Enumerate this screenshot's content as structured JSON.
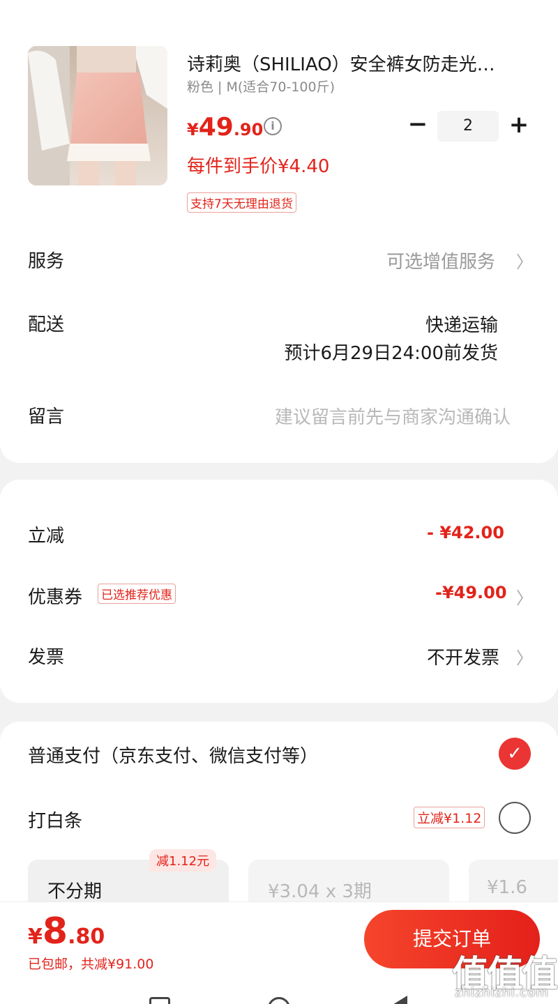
{
  "product": {
    "title": "诗莉奥（SHILIAO）安全裤女防走光…",
    "spec": "粉色 | M(适合70-100斤)",
    "price_currency": "¥",
    "price_int": "49",
    "price_dec": ".90",
    "unit_price": "每件到手价¥4.40",
    "returns_badge": "支持7天无理由退货",
    "quantity": "2",
    "minus": "−",
    "plus": "+"
  },
  "rows": {
    "service_label": "服务",
    "service_value": "可选增值服务",
    "delivery_label": "配送",
    "delivery_method": "快递运输",
    "delivery_eta": "预计6月29日24:00前发货",
    "message_label": "留言",
    "message_placeholder": "建议留言前先与商家沟通确认"
  },
  "discounts": {
    "instant_label": "立减",
    "instant_value": "- ¥42.00",
    "coupon_label": "优惠券",
    "coupon_badge": "已选推荐优惠",
    "coupon_value": "-¥49.00",
    "invoice_label": "发票",
    "invoice_value": "不开发票"
  },
  "payment": {
    "normal_label": "普通支付（京东支付、微信支付等）",
    "baitiao_label": "打白条",
    "baitiao_badge": "立减¥1.12",
    "plans": [
      {
        "label": "不分期",
        "tag": "减1.12元"
      },
      {
        "label": "¥3.04 x 3期"
      },
      {
        "label": "¥1.6"
      }
    ]
  },
  "bottom": {
    "total_currency": "¥",
    "total_int": "8",
    "total_dec": ".80",
    "ship_info": "已包邮，共减¥91.00",
    "submit": "提交订单"
  },
  "watermark": {
    "chars": "值值值",
    "url": "zhizhizhi.com"
  },
  "colors": {
    "accent": "#e2231a",
    "background": "#f2f2f2"
  }
}
